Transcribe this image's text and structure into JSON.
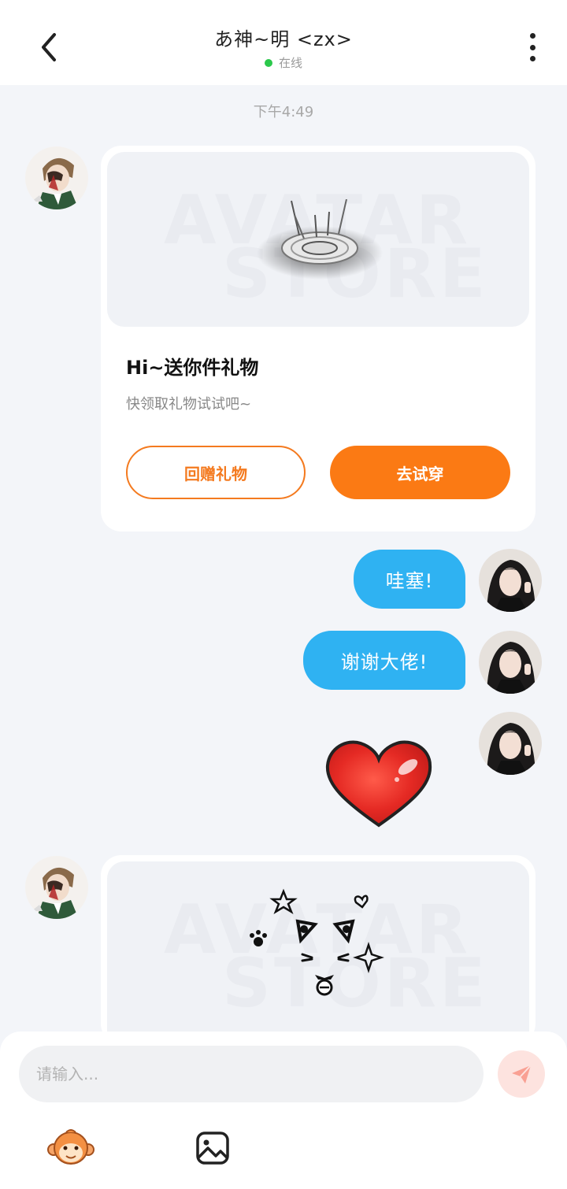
{
  "header": {
    "title": "あ神~明 <zx>",
    "status": "在线"
  },
  "chat": {
    "timestamp": "下午4:49",
    "gift_card": {
      "title": "Hi~送你件礼物",
      "subtitle": "快领取礼物试试吧~",
      "return_gift_label": "回赠礼物",
      "try_on_label": "去试穿",
      "watermark_line1": "AVATAR",
      "watermark_line2": "STORE"
    },
    "messages": [
      {
        "text": "哇塞!"
      },
      {
        "text": "谢谢大佬!"
      }
    ],
    "sticker": "heart",
    "card2": {
      "watermark_line1": "AVATAR",
      "watermark_line2": "STORE"
    }
  },
  "composer": {
    "placeholder": "请输入..."
  },
  "colors": {
    "accent_orange": "#fb7a14",
    "bubble_blue": "#2fb2f2",
    "online_green": "#2bc84b"
  }
}
